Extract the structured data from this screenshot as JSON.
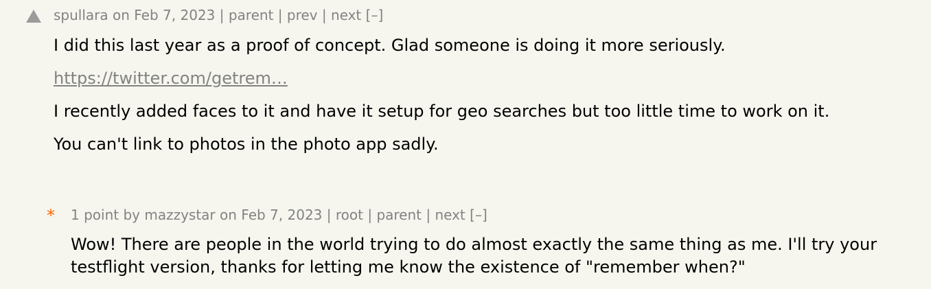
{
  "colors": {
    "background": "#f6f6ef",
    "meta_text": "#828282",
    "upvote": "#9b9b9b",
    "new_marker": "#ff6600"
  },
  "comment1": {
    "author": "spullara",
    "date": "on Feb 7, 2023",
    "links": {
      "parent": "parent",
      "prev": "prev",
      "next": "next",
      "toggle": "[–]"
    },
    "paragraph1": "I did this last year as a proof of concept. Glad someone is doing it more seriously.",
    "link_text": "https://twitter.com/getrem…",
    "paragraph2": "I recently added faces to it and have it setup for geo searches but too little time to work on it.",
    "paragraph3": "You can't link to photos in the photo app sadly."
  },
  "comment2": {
    "marker": "*",
    "points": "1 point",
    "by": "by",
    "author": "mazzystar",
    "date": "on Feb 7, 2023",
    "links": {
      "root": "root",
      "parent": "parent",
      "next": "next",
      "toggle": "[–]"
    },
    "paragraph1": "Wow! There are people in the world trying to do almost exactly the same thing as me. I'll try your testflight version, thanks for letting me know the existence of \"remember when?\""
  }
}
